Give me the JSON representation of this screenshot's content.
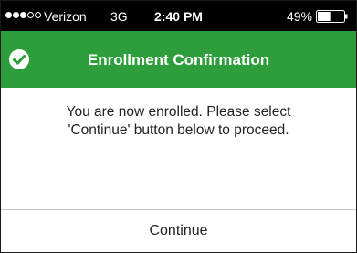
{
  "status_bar": {
    "signal_bars_filled": 3,
    "signal_bars_total": 5,
    "carrier": "Verizon",
    "network": "3G",
    "time": "2:40 PM",
    "battery_percent": "49%",
    "battery_level": 0.49
  },
  "header": {
    "icon": "checkmark-circle-icon",
    "title": "Enrollment Confirmation",
    "color": "#2e9d3b"
  },
  "body": {
    "message_line_1": "You are now enrolled.  Please select",
    "message_line_2": "'Continue' button below to proceed."
  },
  "actions": {
    "continue_label": "Continue"
  }
}
